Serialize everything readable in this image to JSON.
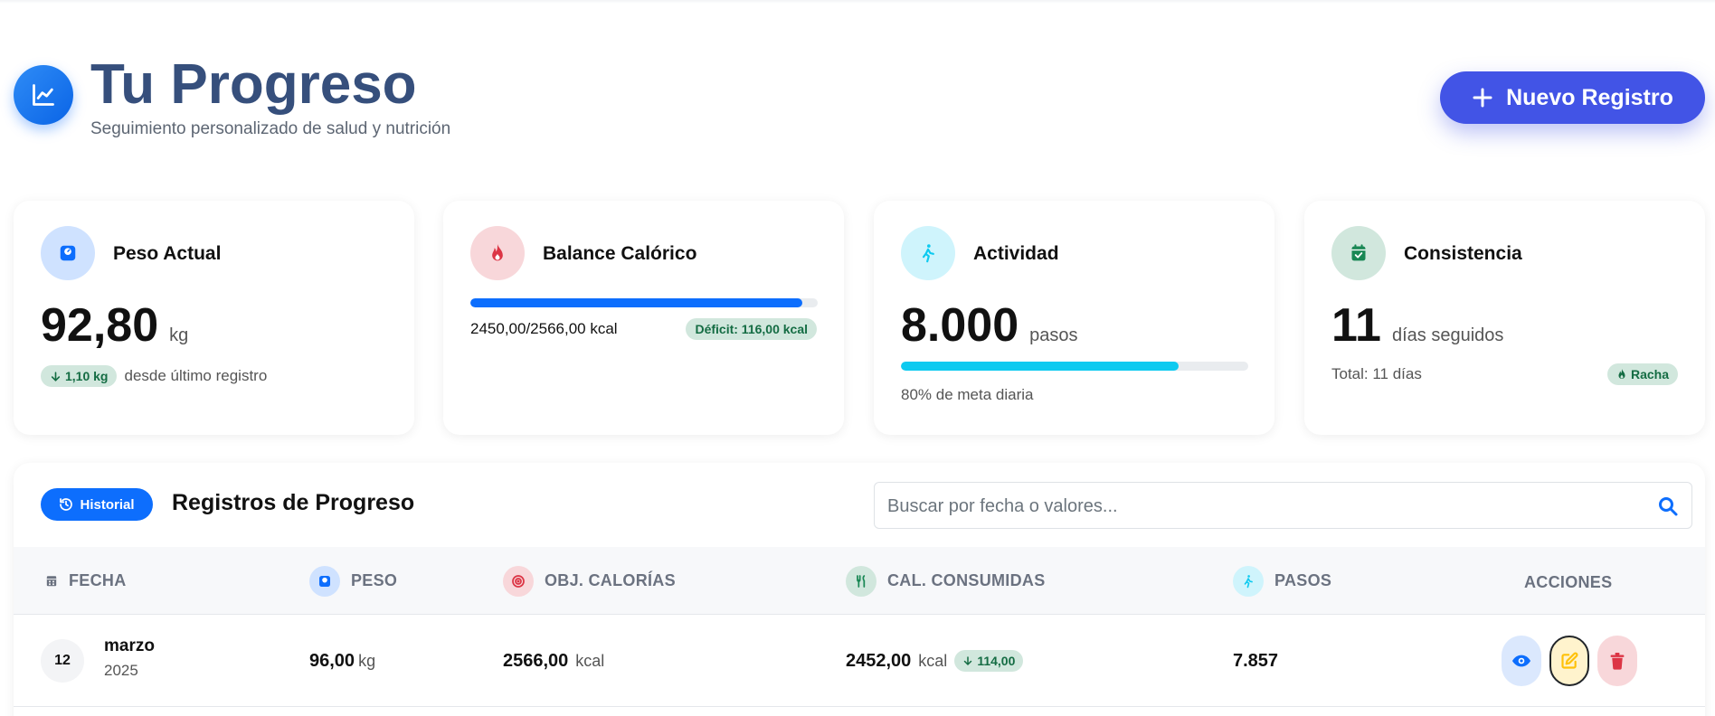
{
  "header": {
    "title": "Tu Progreso",
    "subtitle": "Seguimiento personalizado de salud y nutrición",
    "new_button": "Nuevo Registro"
  },
  "cards": {
    "peso": {
      "title": "Peso Actual",
      "value": "92,80",
      "unit": "kg",
      "delta": "1,10 kg",
      "note": "desde último registro"
    },
    "balance": {
      "title": "Balance Calórico",
      "consumed_text": "2450,00/2566,00 kcal",
      "deficit": "Déficit: 116,00 kcal",
      "progress": 0.955
    },
    "actividad": {
      "title": "Actividad",
      "value": "8.000",
      "unit": "pasos",
      "progress": 0.8,
      "note": "80% de meta diaria"
    },
    "consistencia": {
      "title": "Consistencia",
      "value": "11",
      "unit": "días seguidos",
      "total": "Total: 11 días",
      "badge": "Racha"
    }
  },
  "records": {
    "badge": "Historial",
    "title": "Registros de Progreso",
    "search_placeholder": "Buscar por fecha o valores...",
    "columns": {
      "fecha": "FECHA",
      "peso": "PESO",
      "obj_calorias": "OBJ. CALORÍAS",
      "cal_consumidas": "CAL. CONSUMIDAS",
      "pasos": "PASOS",
      "acciones": "ACCIONES"
    },
    "rows": [
      {
        "day": "12",
        "month": "marzo",
        "year": "2025",
        "peso": "96,00",
        "peso_unit": "kg",
        "obj": "2566,00",
        "obj_unit": "kcal",
        "consumidas": "2452,00",
        "consumidas_unit": "kcal",
        "diff": "114,00",
        "pasos": "7.857"
      }
    ]
  },
  "colors": {
    "primary": "#0d6efd",
    "accent_button": "#4254e6",
    "title": "#364f7c",
    "success_bg": "#d1e7dd",
    "success_text": "#146c43",
    "cyan": "#0dcaf0",
    "danger": "#dc3545",
    "warning": "#ffc107"
  },
  "icons": {
    "header": "chart-line-icon",
    "new": "plus-icon",
    "peso": "weight-scale-icon",
    "balance": "fire-icon",
    "actividad": "walking-icon",
    "consistencia": "calendar-check-icon",
    "historial": "history-icon",
    "search": "search-icon",
    "view": "eye-icon",
    "edit": "edit-icon",
    "delete": "trash-icon"
  }
}
